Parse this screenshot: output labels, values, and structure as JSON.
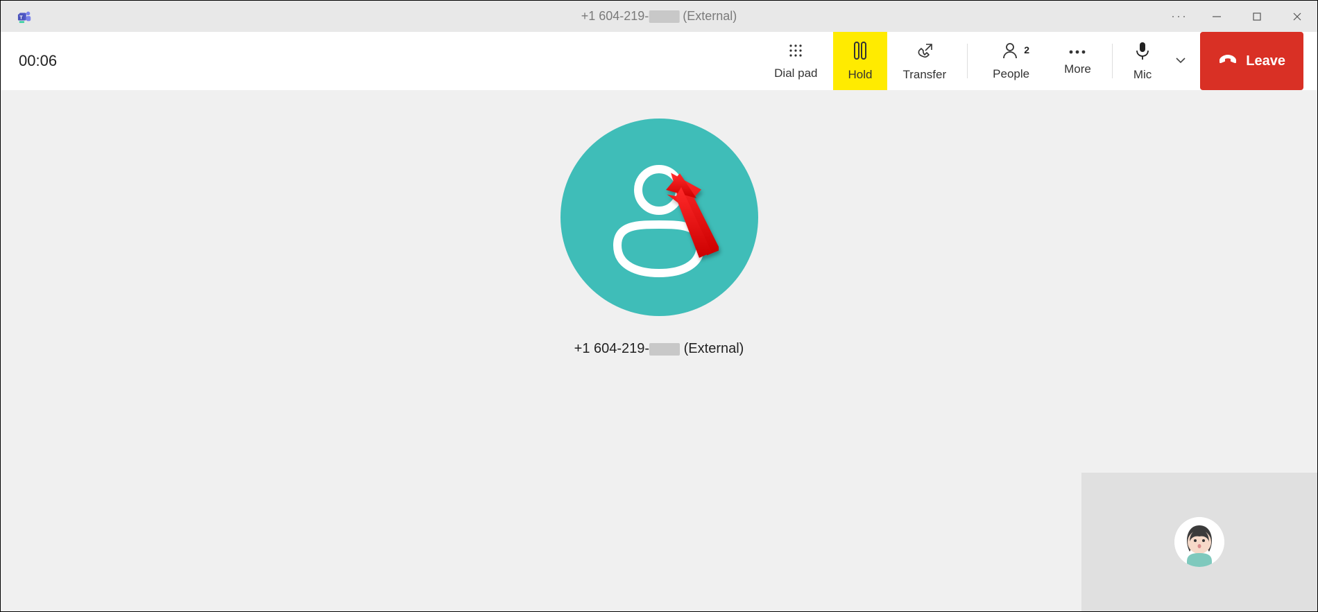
{
  "title": {
    "phone_prefix": "+1 604-219-",
    "suffix": " (External)"
  },
  "timer": "00:06",
  "toolbar": {
    "dialpad": "Dial pad",
    "hold": "Hold",
    "transfer": "Transfer",
    "people": "People",
    "people_count": "2",
    "more": "More",
    "mic": "Mic",
    "leave": "Leave"
  },
  "caller": {
    "phone_prefix": "+1 604-219-",
    "suffix": " (External)"
  }
}
